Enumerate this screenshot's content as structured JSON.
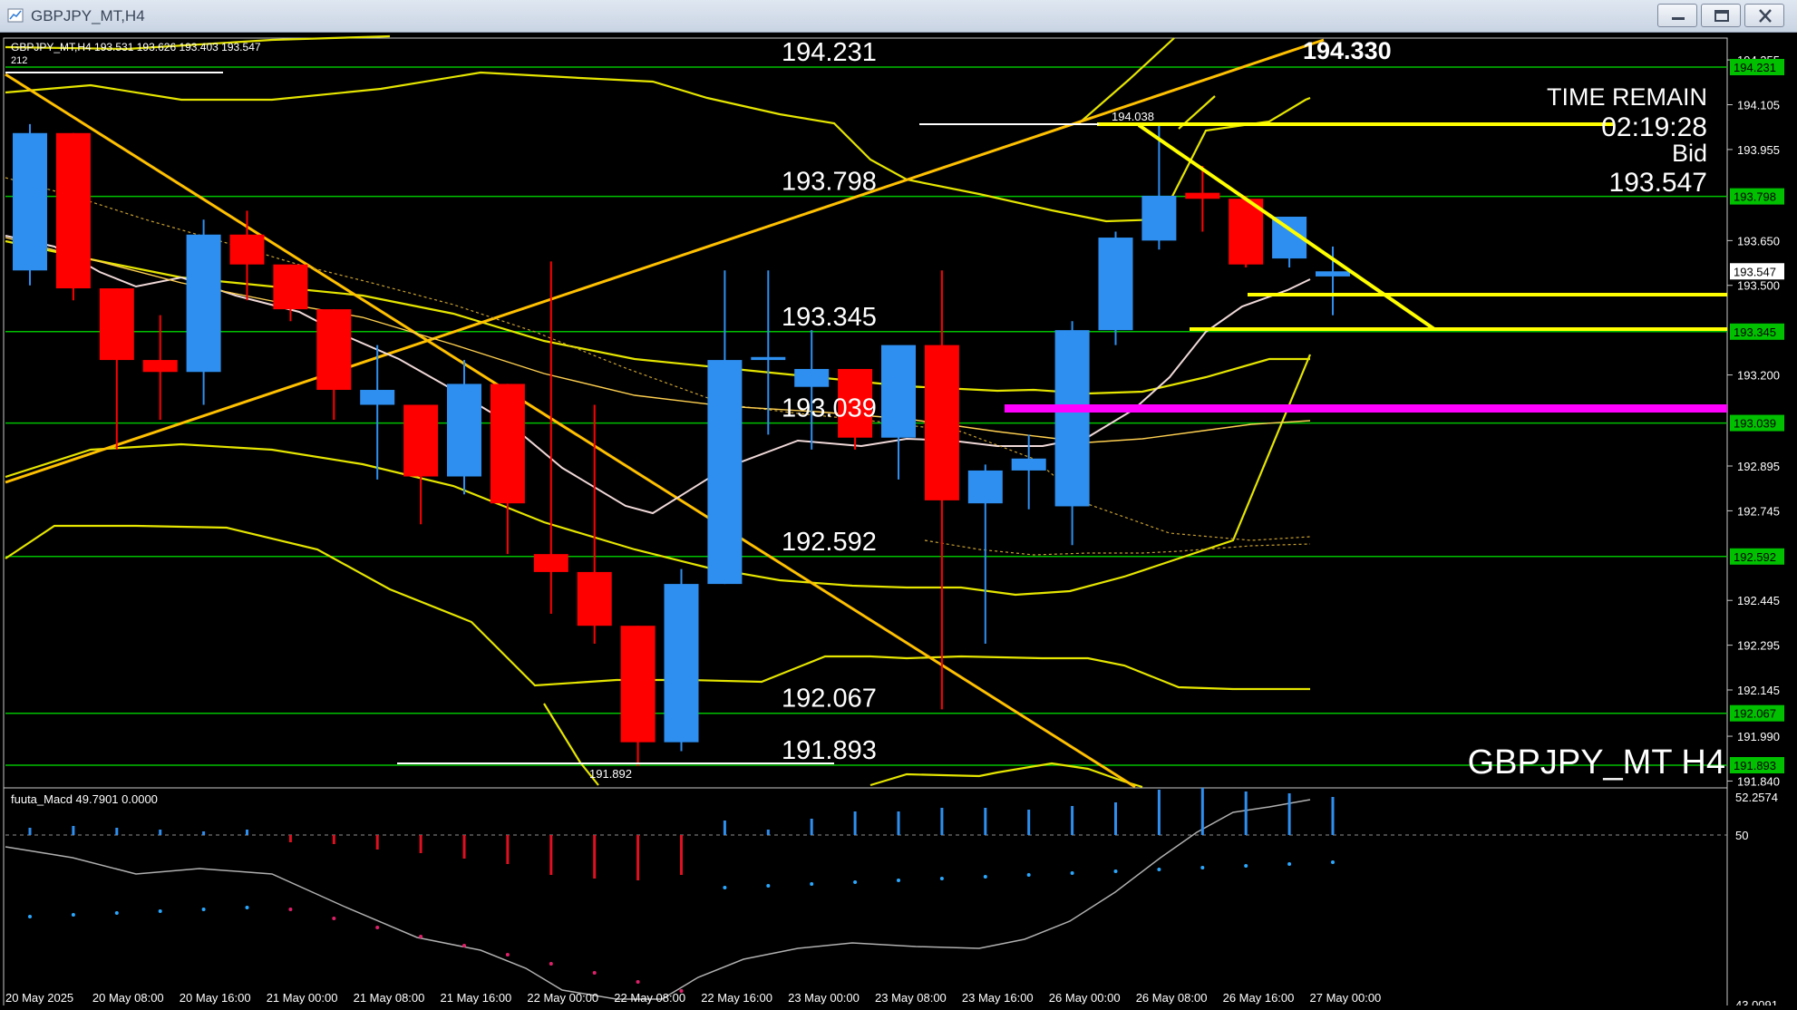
{
  "window": {
    "title": "GBPJPY_MT,H4",
    "buttons": [
      "minimize",
      "maximize",
      "close"
    ]
  },
  "chart": {
    "symbol_info": "GBPJPY_MT,H4  193.531 193.626 193.403 193.547",
    "sub_label": "212",
    "watermark": "GBPJPY_MT H4",
    "time_remain_label": "TIME REMAIN",
    "time_remain_value": "02:19:28",
    "bid_label": "Bid",
    "bid_value": "193.547",
    "high_label": "194.330",
    "peak_label": "194.038",
    "low_label": "191.892",
    "level_labels": [
      "194.231",
      "193.798",
      "193.345",
      "193.039",
      "192.592",
      "192.067",
      "191.893"
    ],
    "price_axis_ticks": [
      "194.255",
      "194.105",
      "193.955",
      "193.650",
      "193.500",
      "193.200",
      "192.895",
      "192.745",
      "192.445",
      "192.295",
      "192.145",
      "191.990",
      "191.840"
    ],
    "price_axis_badges": [
      "194.231",
      "193.798",
      "193.547",
      "193.345",
      "193.039",
      "192.592",
      "192.067",
      "191.893"
    ],
    "time_axis": [
      "20 May 2025",
      "20 May 08:00",
      "20 May 16:00",
      "21 May 00:00",
      "21 May 08:00",
      "21 May 16:00",
      "22 May 00:00",
      "22 May 08:00",
      "22 May 16:00",
      "23 May 00:00",
      "23 May 08:00",
      "23 May 16:00",
      "26 May 00:00",
      "26 May 08:00",
      "26 May 16:00",
      "27 May 00:00"
    ],
    "colors": {
      "background": "#000000",
      "bull": "#2e8ff0",
      "bear": "#ff0000",
      "level_line": "#00c000",
      "trendline": "#ffd700",
      "envelope": "#e5e500",
      "highlight": "#ff00ff",
      "ma": "#f0d8d8"
    }
  },
  "indicator": {
    "label": "fuuta_Macd 49.7901  0.0000",
    "axis_ticks": [
      "52.2574",
      "50",
      "43.0091"
    ]
  },
  "chart_data": {
    "type": "candlestick",
    "ylim": [
      191.84,
      194.33
    ],
    "candles": [
      {
        "open": 193.55,
        "high": 194.04,
        "low": 193.5,
        "close": 194.01
      },
      {
        "open": 194.01,
        "high": 194.01,
        "low": 193.45,
        "close": 193.49
      },
      {
        "open": 193.49,
        "high": 193.49,
        "low": 192.95,
        "close": 193.25
      },
      {
        "open": 193.25,
        "high": 193.4,
        "low": 193.05,
        "close": 193.21
      },
      {
        "open": 193.21,
        "high": 193.72,
        "low": 193.1,
        "close": 193.67
      },
      {
        "open": 193.67,
        "high": 193.75,
        "low": 193.45,
        "close": 193.57
      },
      {
        "open": 193.57,
        "high": 193.57,
        "low": 193.38,
        "close": 193.42
      },
      {
        "open": 193.42,
        "high": 193.42,
        "low": 193.05,
        "close": 193.15
      },
      {
        "open": 193.1,
        "high": 193.3,
        "low": 192.85,
        "close": 193.15
      },
      {
        "open": 193.1,
        "high": 193.1,
        "low": 192.7,
        "close": 192.86
      },
      {
        "open": 192.86,
        "high": 193.25,
        "low": 192.8,
        "close": 193.17
      },
      {
        "open": 193.17,
        "high": 193.17,
        "low": 192.6,
        "close": 192.77
      },
      {
        "open": 192.6,
        "high": 193.58,
        "low": 192.4,
        "close": 192.54
      },
      {
        "open": 192.54,
        "high": 193.1,
        "low": 192.3,
        "close": 192.36
      },
      {
        "open": 192.36,
        "high": 192.36,
        "low": 191.89,
        "close": 191.97
      },
      {
        "open": 191.97,
        "high": 192.55,
        "low": 191.94,
        "close": 192.5
      },
      {
        "open": 192.5,
        "high": 193.55,
        "low": 192.5,
        "close": 193.25
      },
      {
        "open": 193.25,
        "high": 193.55,
        "low": 193.0,
        "close": 193.26
      },
      {
        "open": 193.16,
        "high": 193.35,
        "low": 192.95,
        "close": 193.22
      },
      {
        "open": 193.22,
        "high": 193.22,
        "low": 192.95,
        "close": 192.99
      },
      {
        "open": 192.99,
        "high": 193.28,
        "low": 192.85,
        "close": 193.3
      },
      {
        "open": 193.3,
        "high": 193.55,
        "low": 192.08,
        "close": 192.78
      },
      {
        "open": 192.77,
        "high": 192.9,
        "low": 192.3,
        "close": 192.88
      },
      {
        "open": 192.88,
        "high": 193.0,
        "low": 192.75,
        "close": 192.92
      },
      {
        "open": 192.76,
        "high": 193.38,
        "low": 192.63,
        "close": 193.35
      },
      {
        "open": 193.35,
        "high": 193.68,
        "low": 193.3,
        "close": 193.66
      },
      {
        "open": 193.65,
        "high": 194.04,
        "low": 193.62,
        "close": 193.8
      },
      {
        "open": 193.81,
        "high": 193.9,
        "low": 193.68,
        "close": 193.79
      },
      {
        "open": 193.79,
        "high": 193.8,
        "low": 193.56,
        "close": 193.57
      },
      {
        "open": 193.59,
        "high": 193.73,
        "low": 193.56,
        "close": 193.73
      },
      {
        "open": 193.53,
        "high": 193.63,
        "low": 193.4,
        "close": 193.547
      }
    ],
    "horizontal_levels": [
      194.231,
      193.798,
      193.345,
      193.039,
      192.592,
      192.067,
      191.893
    ]
  }
}
